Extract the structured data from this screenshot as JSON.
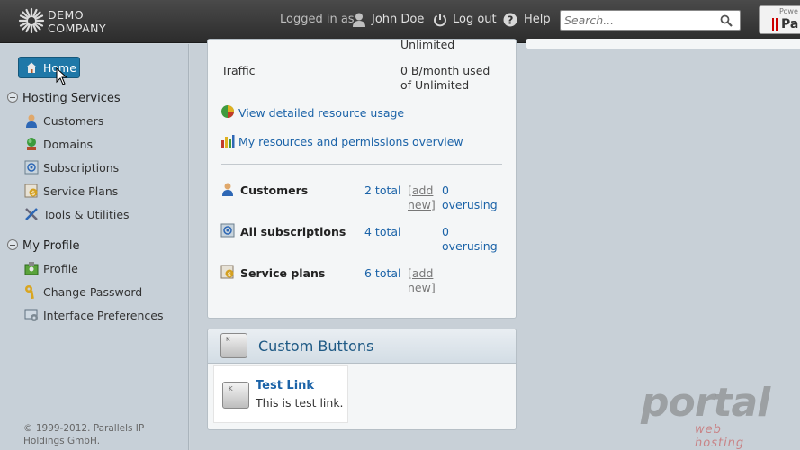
{
  "header": {
    "logo_line1": "DEMO",
    "logo_line2": "COMPANY",
    "logged_in_as": "Logged in as",
    "user_name": "John Doe",
    "logout_label": "Log out",
    "help_label": "Help",
    "search_placeholder": "Search...",
    "powered_by": "Powe",
    "powered_brand": "Pa"
  },
  "sidebar": {
    "home_label": "Home",
    "sections": [
      {
        "title": "Hosting Services",
        "items": [
          {
            "label": "Customers",
            "icon": "customer-icon"
          },
          {
            "label": "Domains",
            "icon": "domain-icon"
          },
          {
            "label": "Subscriptions",
            "icon": "subscription-icon"
          },
          {
            "label": "Service Plans",
            "icon": "service-plan-icon"
          },
          {
            "label": "Tools & Utilities",
            "icon": "tools-icon"
          }
        ]
      },
      {
        "title": "My Profile",
        "items": [
          {
            "label": "Profile",
            "icon": "profile-icon"
          },
          {
            "label": "Change Password",
            "icon": "key-icon"
          },
          {
            "label": "Interface Preferences",
            "icon": "preferences-icon"
          }
        ]
      }
    ],
    "copyright": "© 1999-2012. Parallels IP Holdings GmbH."
  },
  "resources": {
    "top_value": "Unlimited",
    "traffic_label": "Traffic",
    "traffic_value_1": "0 B/month used",
    "traffic_value_2": "of Unlimited",
    "link_usage": "View detailed resource usage",
    "link_permissions": "My resources and permissions overview"
  },
  "summary": {
    "rows": [
      {
        "label": "Customers",
        "total": "2 total",
        "add": "[add new]",
        "over1": "0",
        "over2": "overusing"
      },
      {
        "label": "All subscriptions",
        "total": "4 total",
        "over1": "0",
        "over2": "overusing"
      },
      {
        "label": "Service plans",
        "total": "6 total",
        "add": "[add new]"
      }
    ]
  },
  "custom_buttons": {
    "title": "Custom Buttons",
    "key_letter": "K",
    "link_title": "Test Link",
    "link_desc": "This is test link."
  },
  "watermark": {
    "brand": "portal",
    "tagline": "web hosting"
  },
  "colors": {
    "link": "#1b63a8",
    "home_button": "#1f78a8",
    "topbar": "#333333"
  }
}
